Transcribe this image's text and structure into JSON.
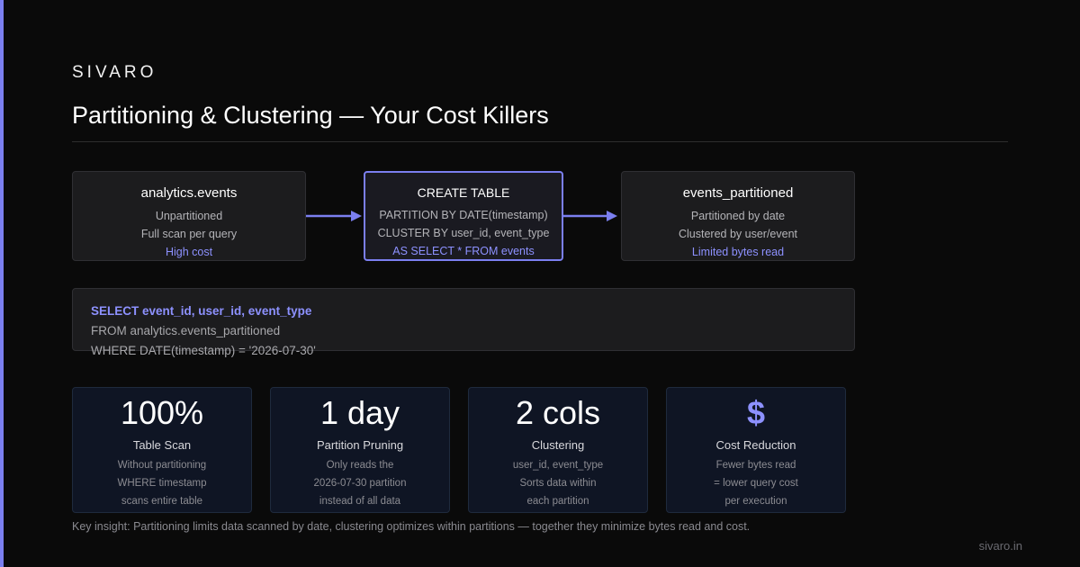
{
  "brand": "SIVARO",
  "title": "Partitioning & Clustering — Your Cost Killers",
  "colors": {
    "accent": "#7b7ff0",
    "accent_text": "#8d91ff",
    "background": "#0a0a0a",
    "card": "#1c1c1e",
    "stat_card": "#0f1524"
  },
  "flow": {
    "source": {
      "title": "analytics.events",
      "lines": [
        "Unpartitioned",
        "Full scan per query"
      ],
      "highlight": "High cost"
    },
    "transform": {
      "title": "CREATE TABLE",
      "lines": [
        "PARTITION BY DATE(timestamp)",
        "CLUSTER BY user_id, event_type"
      ],
      "highlight": "AS SELECT * FROM events"
    },
    "target": {
      "title": "events_partitioned",
      "lines": [
        "Partitioned by date",
        "Clustered by user/event"
      ],
      "highlight": "Limited bytes read"
    }
  },
  "query": {
    "lines": [
      "SELECT event_id, user_id, event_type",
      "FROM analytics.events_partitioned",
      "WHERE DATE(timestamp) = '2026-07-30'"
    ]
  },
  "stats": [
    {
      "value": "100%",
      "label": "Table Scan",
      "desc": [
        "Without partitioning",
        "WHERE timestamp",
        "scans entire table"
      ]
    },
    {
      "value": "1 day",
      "label": "Partition Pruning",
      "desc": [
        "Only reads the",
        "2026-07-30 partition",
        "instead of all data"
      ]
    },
    {
      "value": "2 cols",
      "label": "Clustering",
      "desc": [
        "user_id, event_type",
        "Sorts data within",
        "each partition"
      ]
    },
    {
      "value": "$",
      "label": "Cost Reduction",
      "desc": [
        "Fewer bytes read",
        "= lower query cost",
        "per execution"
      ],
      "icon": "dollar-icon"
    }
  ],
  "insight": "Key insight: Partitioning limits data scanned by date, clustering optimizes within partitions — together they minimize bytes read and cost.",
  "footer": "sivaro.in"
}
